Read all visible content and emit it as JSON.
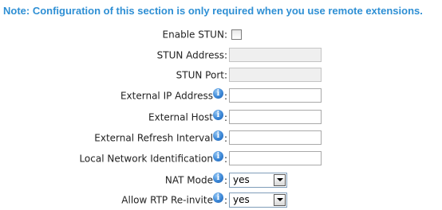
{
  "note": "Note: Configuration of this section is only required when you use remote extensions.",
  "fields": {
    "enable_stun": {
      "label": "Enable STUN:",
      "checked": false
    },
    "stun_address": {
      "label": "STUN Address:",
      "value": ""
    },
    "stun_port": {
      "label": "STUN Port:",
      "value": ""
    },
    "external_ip": {
      "label": "External IP Address",
      "colon": ":",
      "value": ""
    },
    "external_host": {
      "label": "External Host",
      "colon": ":",
      "value": ""
    },
    "external_refresh": {
      "label": "External Refresh Interval",
      "colon": ":",
      "value": ""
    },
    "local_network": {
      "label": "Local Network Identification",
      "colon": ":",
      "value": ""
    },
    "nat_mode": {
      "label": "NAT Mode",
      "colon": ":",
      "selected": "yes"
    },
    "allow_rtp": {
      "label": "Allow RTP Re-invite",
      "colon": ":",
      "selected": "yes"
    }
  },
  "icons": {
    "info": "info-icon",
    "info_glyph": "i"
  },
  "colors": {
    "note": "#2e8fd4",
    "info_icon": "#3a86d6"
  }
}
